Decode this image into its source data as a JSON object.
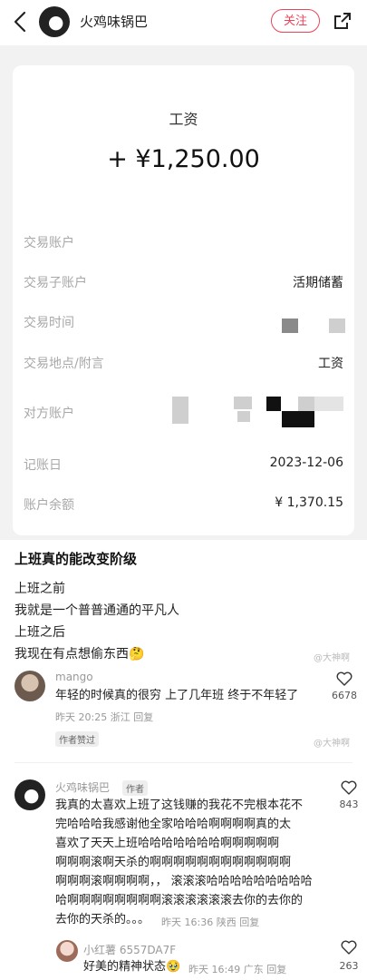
{
  "header": {
    "author": "火鸡味锅巴",
    "follow_label": "关注"
  },
  "receipt": {
    "category": "工资",
    "amount": "+ ¥1,250.00",
    "rows": [
      {
        "label": "交易账户",
        "value": ""
      },
      {
        "label": "交易子账户",
        "value": "活期储蓄"
      },
      {
        "label": "交易时间",
        "value": ""
      },
      {
        "label": "交易地点/附言",
        "value": "工资"
      },
      {
        "label": "对方账户",
        "value": ""
      },
      {
        "label": "记账日",
        "value": "2023-12-06"
      },
      {
        "label": "账户余额",
        "value": "¥ 1,370.15"
      }
    ]
  },
  "post": {
    "title": "上班真的能改变阶级",
    "lines": [
      "上班之前",
      "我就是一个普普通通的平凡人",
      "上班之后",
      "我现在有点想偷东西🤔"
    ],
    "watermark": "@大神啊"
  },
  "comments": [
    {
      "name": "mango",
      "text": "年轻的时候真的很穷 上了几年班 终于不年轻了",
      "meta": "昨天 20:25 浙江 回复",
      "likes": "6678",
      "badge": "作者赞过"
    },
    {
      "name": "火鸡味锅巴",
      "author_tag": "作者",
      "lines": [
        "我真的太喜欢上班了这钱赚的我花不完根本花不",
        "完哈哈哈我感谢他全家哈哈哈啊啊啊啊真的太",
        "喜欢了天天上班哈哈哈哈哈哈哈啊啊啊啊啊",
        "啊啊啊滚啊天杀的啊啊啊啊啊啊啊啊啊啊啊啊",
        "啊啊啊滚啊啊啊啊，，  滚滚滚哈哈哈哈哈哈哈哈哈",
        "哈啊啊啊啊啊啊啊啊滚滚滚滚滚滚去你的去你的",
        "去你的天杀的。。。"
      ],
      "meta": "昨天 16:36 陕西 回复",
      "likes": "843"
    },
    {
      "name": "小红薯 6557DA7F",
      "text": "好美的精神状态🥹",
      "meta": "昨天 16:49 广东 回复",
      "likes": "263"
    }
  ]
}
